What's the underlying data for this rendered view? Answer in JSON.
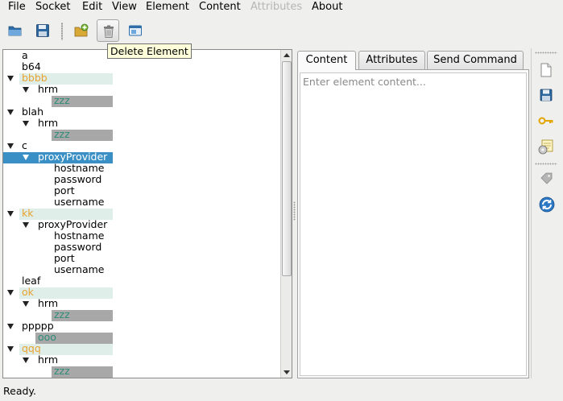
{
  "menu": {
    "file": "File",
    "socket": "Socket",
    "edit": "Edit",
    "view": "View",
    "element": "Element",
    "content": "Content",
    "attributes": "Attributes",
    "about": "About"
  },
  "toolbar": {
    "open_icon": "folder-open-icon",
    "save_icon": "floppy-disk-icon",
    "add_icon": "add-element-icon",
    "delete_icon": "trash-icon",
    "window_icon": "window-icon"
  },
  "tooltip": {
    "text": "Delete Element"
  },
  "tree": {
    "rows": [
      {
        "label": "a",
        "depth": 0,
        "expander": false,
        "style": "plain"
      },
      {
        "label": "b64",
        "depth": 0,
        "expander": false,
        "style": "plain"
      },
      {
        "label": "bbbb",
        "depth": 0,
        "expander": true,
        "style": "folder"
      },
      {
        "label": "hrm",
        "depth": 1,
        "expander": true,
        "style": "plain"
      },
      {
        "label": "zzz",
        "depth": 2,
        "expander": false,
        "style": "value"
      },
      {
        "label": "blah",
        "depth": 0,
        "expander": true,
        "style": "plain"
      },
      {
        "label": "hrm",
        "depth": 1,
        "expander": true,
        "style": "plain"
      },
      {
        "label": "zzz",
        "depth": 2,
        "expander": false,
        "style": "value"
      },
      {
        "label": "c",
        "depth": 0,
        "expander": true,
        "style": "plain"
      },
      {
        "label": "proxyProvider",
        "depth": 1,
        "expander": true,
        "style": "selected"
      },
      {
        "label": "hostname",
        "depth": 2,
        "expander": false,
        "style": "plain"
      },
      {
        "label": "password",
        "depth": 2,
        "expander": false,
        "style": "plain"
      },
      {
        "label": "port",
        "depth": 2,
        "expander": false,
        "style": "plain"
      },
      {
        "label": "username",
        "depth": 2,
        "expander": false,
        "style": "plain"
      },
      {
        "label": "kk",
        "depth": 0,
        "expander": true,
        "style": "folder"
      },
      {
        "label": "proxyProvider",
        "depth": 1,
        "expander": true,
        "style": "plain"
      },
      {
        "label": "hostname",
        "depth": 2,
        "expander": false,
        "style": "plain"
      },
      {
        "label": "password",
        "depth": 2,
        "expander": false,
        "style": "plain"
      },
      {
        "label": "port",
        "depth": 2,
        "expander": false,
        "style": "plain"
      },
      {
        "label": "username",
        "depth": 2,
        "expander": false,
        "style": "plain"
      },
      {
        "label": "leaf",
        "depth": 0,
        "expander": false,
        "style": "plain"
      },
      {
        "label": "ok",
        "depth": 0,
        "expander": true,
        "style": "folder"
      },
      {
        "label": "hrm",
        "depth": 1,
        "expander": true,
        "style": "plain"
      },
      {
        "label": "zzz",
        "depth": 2,
        "expander": false,
        "style": "value"
      },
      {
        "label": "ppppp",
        "depth": 0,
        "expander": true,
        "style": "plain"
      },
      {
        "label": "ooo",
        "depth": 1,
        "expander": false,
        "style": "value"
      },
      {
        "label": "qqq",
        "depth": 0,
        "expander": true,
        "style": "folder"
      },
      {
        "label": "hrm",
        "depth": 1,
        "expander": true,
        "style": "plain"
      },
      {
        "label": "zzz",
        "depth": 2,
        "expander": false,
        "style": "value"
      }
    ]
  },
  "tabs": {
    "content": "Content",
    "attributes": "Attributes",
    "send_command": "Send Command"
  },
  "editor": {
    "placeholder": "Enter element content..."
  },
  "side_toolbar": [
    "new-document-icon",
    "save-icon",
    "key-icon",
    "connect-icon",
    "tag-icon",
    "refresh-icon"
  ],
  "status": {
    "text": "Ready."
  }
}
